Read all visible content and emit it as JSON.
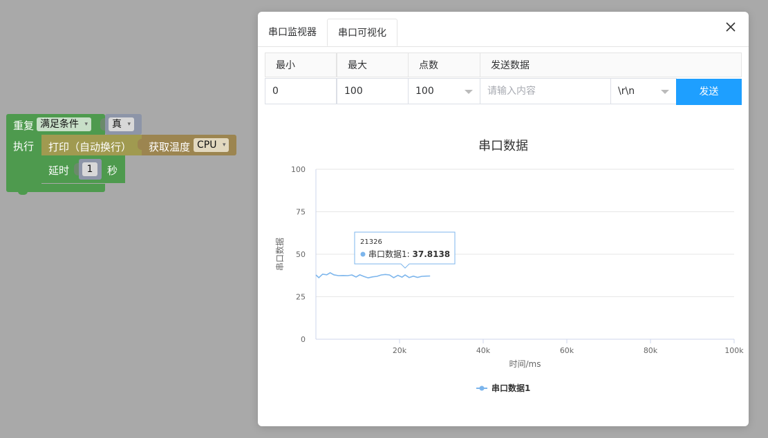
{
  "blocks": {
    "repeat_label": "重复",
    "condition_dropdown": "满足条件",
    "true_dropdown": "真",
    "do_label": "执行",
    "print_label": "打印（自动换行）",
    "get_temp_label": "获取温度",
    "cpu_dropdown": "CPU",
    "delay_label": "延时",
    "delay_value": "1",
    "seconds_label": "秒",
    "colors": {
      "loop": "#4e9a4e",
      "print": "#a09a50",
      "sensor": "#9c8550"
    }
  },
  "modal": {
    "tabs": [
      {
        "label": "串口监视器",
        "active": false
      },
      {
        "label": "串口可视化",
        "active": true
      }
    ],
    "close_icon": "close-icon",
    "form": {
      "min_label": "最小",
      "max_label": "最大",
      "points_label": "点数",
      "send_data_label": "发送数据",
      "min_value": "0",
      "max_value": "100",
      "points_value": "100",
      "send_placeholder": "请输入内容",
      "line_ending_value": "\\r\\n",
      "send_button": "发送",
      "accent_color": "#1e9fff"
    }
  },
  "chart_data": {
    "type": "line",
    "title": "串口数据",
    "xlabel": "时间/ms",
    "ylabel": "串口数据",
    "xlim": [
      0,
      100000
    ],
    "ylim": [
      0,
      100
    ],
    "x_ticks": [
      "20k",
      "40k",
      "60k",
      "80k",
      "100k"
    ],
    "y_ticks": [
      "0",
      "25",
      "50",
      "75",
      "100"
    ],
    "grid": true,
    "legend_position": "bottom",
    "series": [
      {
        "name": "串口数据1",
        "color": "#7cb5ec",
        "x": [
          0,
          700,
          1600,
          2600,
          3400,
          4300,
          5400,
          6500,
          7600,
          8600,
          9600,
          10500,
          11500,
          12500,
          13600,
          14600,
          15600,
          16600,
          17600,
          18600,
          19600,
          20600,
          21326,
          22300,
          23300,
          24300,
          25300,
          26300,
          27300
        ],
        "values": [
          37.8,
          36.2,
          38.3,
          37.9,
          39.1,
          37.9,
          37.4,
          37.5,
          37.4,
          37.8,
          36.6,
          37.9,
          36.9,
          36.1,
          36.7,
          37.0,
          37.8,
          38.1,
          37.8,
          36.2,
          37.6,
          36.5,
          37.8138,
          36.3,
          37.1,
          36.4,
          37.0,
          37.1,
          37.2
        ]
      }
    ],
    "tooltip": {
      "x": "21326",
      "series": "串口数据1",
      "value": "37.8138"
    }
  }
}
